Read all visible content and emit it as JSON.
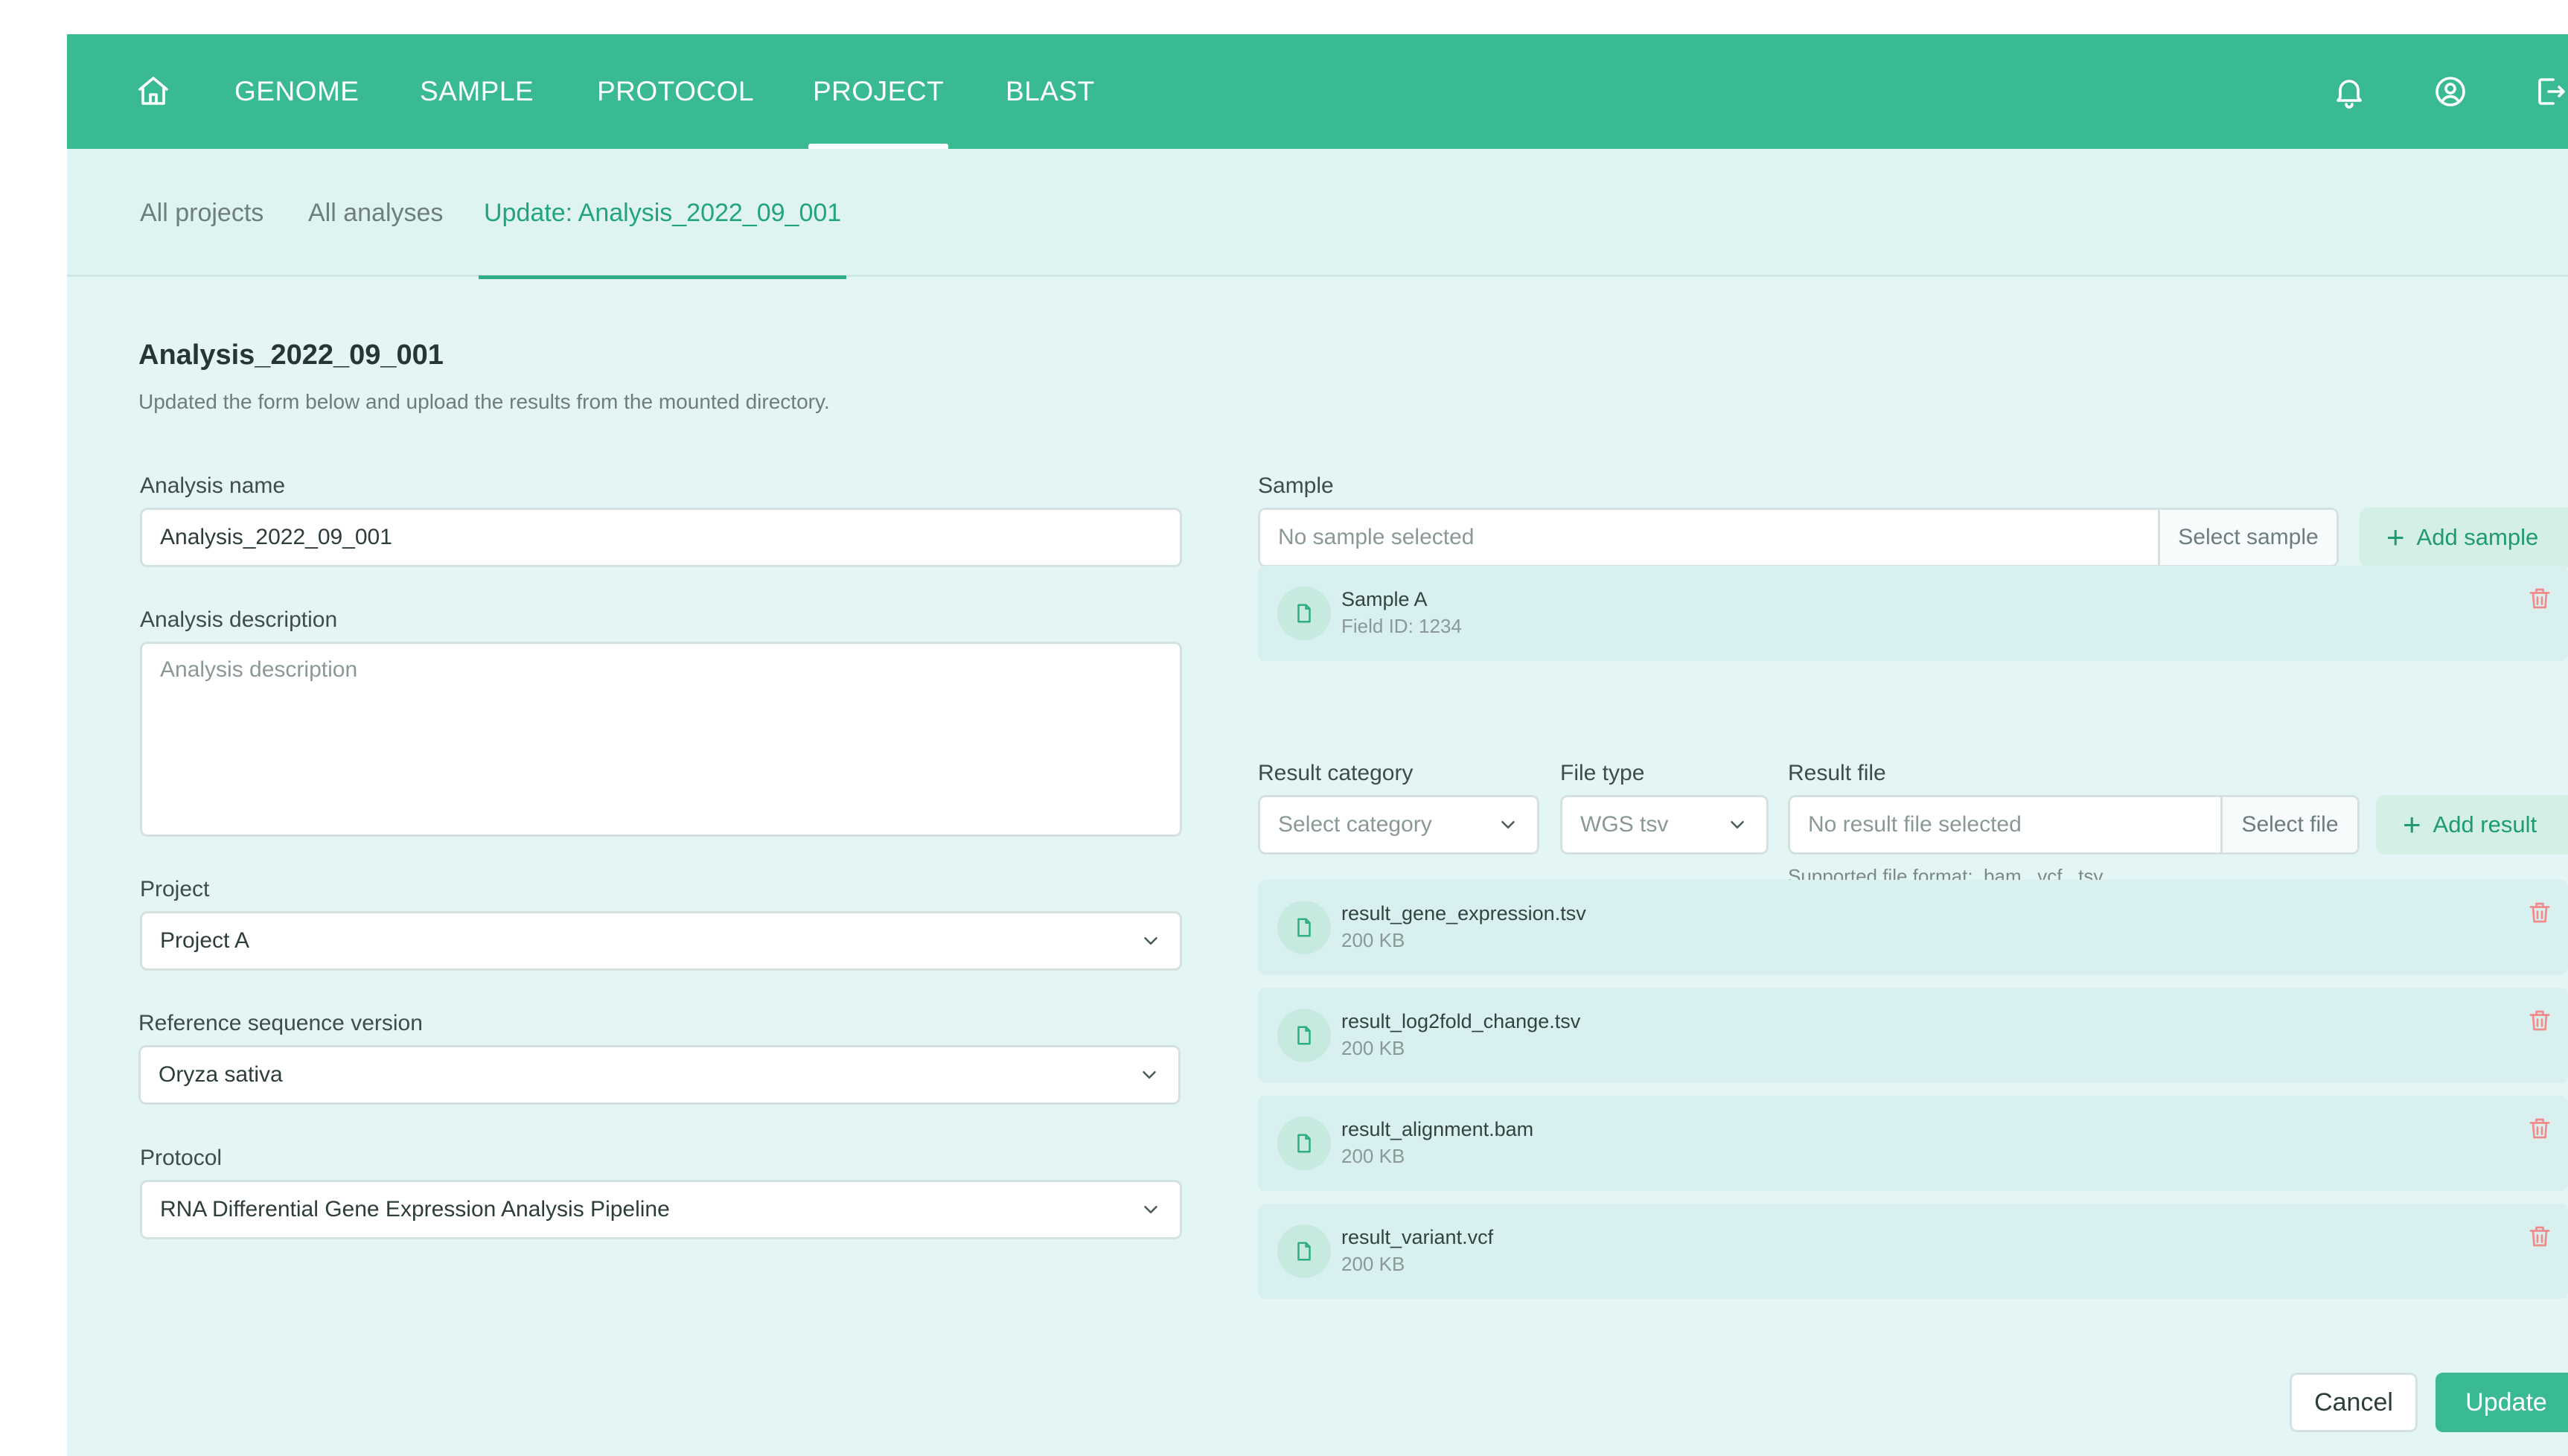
{
  "colors": {
    "brand": "#3aba92",
    "background": "#e3f5f4",
    "active_tab": "#23a57c",
    "danger_icon": "#f28b8b"
  },
  "topnav": {
    "items": [
      {
        "label": "GENOME",
        "active": false
      },
      {
        "label": "SAMPLE",
        "active": false
      },
      {
        "label": "PROTOCOL",
        "active": false
      },
      {
        "label": "PROJECT",
        "active": true
      },
      {
        "label": "BLAST",
        "active": false
      }
    ],
    "icons": [
      "home-icon",
      "bell-icon",
      "user-circle-icon",
      "logout-icon"
    ]
  },
  "subtabs": [
    {
      "label": "All projects",
      "active": false
    },
    {
      "label": "All analyses",
      "active": false
    },
    {
      "label": "Update: Analysis_2022_09_001",
      "active": true
    }
  ],
  "page": {
    "title": "Analysis_2022_09_001",
    "subtitle": "Updated the form below and upload the results from the mounted directory."
  },
  "form": {
    "analysis_name": {
      "label": "Analysis name",
      "value": "Analysis_2022_09_001"
    },
    "analysis_description": {
      "label": "Analysis description",
      "placeholder": "Analysis description",
      "value": ""
    },
    "project": {
      "label": "Project",
      "value": "Project A"
    },
    "reference": {
      "label": "Reference sequence version",
      "value": "Oryza sativa"
    },
    "protocol": {
      "label": "Protocol",
      "value": "RNA Differential Gene Expression Analysis Pipeline"
    }
  },
  "sample": {
    "label": "Sample",
    "placeholder": "No sample selected",
    "select_button": "Select sample",
    "add_button": "Add sample",
    "items": [
      {
        "title": "Sample A",
        "subtitle": "Field ID: 1234"
      }
    ]
  },
  "results": {
    "category": {
      "label": "Result category",
      "placeholder": "Select category"
    },
    "file_type": {
      "label": "File type",
      "value": "WGS tsv"
    },
    "file": {
      "label": "Result file",
      "placeholder": "No result file selected",
      "select_button": "Select file"
    },
    "add_button": "Add result",
    "help": "Supported file format: .bam, .vcf, .tsv",
    "items": [
      {
        "name": "result_gene_expression.tsv",
        "size": "200 KB"
      },
      {
        "name": "result_log2fold_change.tsv",
        "size": "200 KB"
      },
      {
        "name": "result_alignment.bam",
        "size": "200 KB"
      },
      {
        "name": "result_variant.vcf",
        "size": "200 KB"
      }
    ]
  },
  "footer": {
    "cancel": "Cancel",
    "update": "Update"
  }
}
